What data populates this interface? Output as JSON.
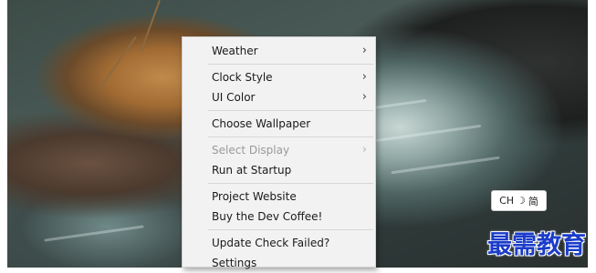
{
  "context_menu": {
    "weather": {
      "label": "Weather",
      "has_submenu": true,
      "arrow": "›"
    },
    "clock_style": {
      "label": "Clock Style",
      "has_submenu": true,
      "arrow": "›"
    },
    "ui_color": {
      "label": "UI Color",
      "has_submenu": true,
      "arrow": "›"
    },
    "choose_wallpaper": {
      "label": "Choose Wallpaper"
    },
    "select_display": {
      "label": "Select Display",
      "disabled": true,
      "has_submenu": true,
      "arrow": "›"
    },
    "run_at_startup": {
      "label": "Run at Startup"
    },
    "project_website": {
      "label": "Project Website"
    },
    "buy_coffee": {
      "label": "Buy the Dev Coffee!"
    },
    "update_check": {
      "label": "Update Check Failed?"
    },
    "settings": {
      "label": "Settings"
    }
  },
  "ime_indicator": {
    "lang": "CH",
    "mode_icon": "moon-icon",
    "mode_glyph": "☽",
    "script": "简"
  },
  "watermark": {
    "text": "最需教育"
  },
  "colors": {
    "menu_background": "#f2f2f2",
    "menu_separator": "#d7d7d7",
    "disabled_text": "#9a9a9a",
    "watermark_blue": "#1b3cc9"
  }
}
